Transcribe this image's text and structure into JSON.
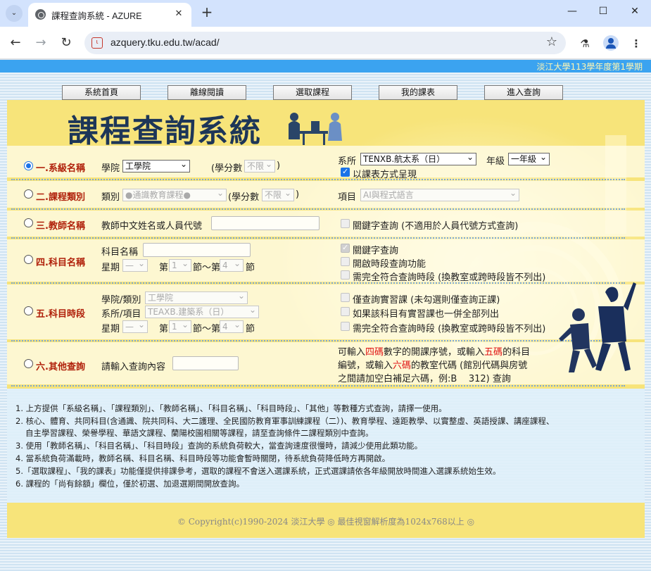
{
  "browser": {
    "tab_title": "課程查詢系統 - AZURE",
    "url": "azquery.tku.edu.tw/acad/"
  },
  "header": {
    "semester": "淡江大學113學年度第1學期"
  },
  "menu": [
    "系統首頁",
    "離線閱讀",
    "選取課程",
    "我的課表",
    "進入查詢"
  ],
  "main": {
    "title": "課程查詢系統",
    "rows": {
      "r1": {
        "label": "一.系級名稱",
        "college_label": "學院",
        "college_value": "工學院",
        "credits_open": "(學分數",
        "credits_value": "不限",
        "credits_close": ")",
        "dept_label": "系所",
        "dept_value": "TENXB.航太系（日）",
        "grade_label": "年級",
        "grade_value": "一年級",
        "timetable_label": "以課表方式呈現"
      },
      "r2": {
        "label": "二.課程類別",
        "type_label": "類別",
        "type_value": "●通識教育課程●",
        "credits_open": "(學分數",
        "credits_value": "不限",
        "credits_close": ")",
        "item_label": "項目",
        "item_value": "AI與程式語言"
      },
      "r3": {
        "label": "三.教師名稱",
        "teacher_label": "教師中文姓名或人員代號",
        "keyword_label": "關鍵字查詢 (不適用於人員代號方式查詢)"
      },
      "r4": {
        "label": "四.科目名稱",
        "subject_label": "科目名稱",
        "week_label": "星期",
        "week_value": "—",
        "period_prefix": "第",
        "period_from": "1",
        "period_mid": "節～第",
        "period_to": "4",
        "period_suffix": "節",
        "opt1": "關鍵字查詢",
        "opt2": "開啟時段查詢功能",
        "opt3": "需完全符合查詢時段 (換教室或跨時段皆不列出)"
      },
      "r5": {
        "label": "五.科目時段",
        "college_label": "學院/類別",
        "college_value": "工學院",
        "dept_label": "系所/項目",
        "dept_value": "TEAXB.建築系（日）",
        "week_label": "星期",
        "week_value": "—",
        "period_prefix": "第",
        "period_from": "1",
        "period_mid": "節～第",
        "period_to": "4",
        "period_suffix": "節",
        "opt1": "僅查詢實習課 (未勾選則僅查詢正課)",
        "opt2": "如果該科目有實習課也一併全部列出",
        "opt3": "需完全符合查詢時段 (換教室或跨時段皆不列出)"
      },
      "r6": {
        "label": "六.其他查詢",
        "input_label": "請輸入查詢內容",
        "help_1a": "可輸入",
        "help_1b": "四碼",
        "help_1c": "數字的開課序號，或輸入",
        "help_1d": "五碼",
        "help_1e": "的科目",
        "help_2a": "編號，或輸入",
        "help_2b": "六碼",
        "help_2c": "的教室代碼 (館別代碼與房號",
        "help_3": "之間請加空白補足六碼，例:B    312) 查詢"
      }
    }
  },
  "notes": [
    "1. 上方提供「系級名稱」、「課程類別」、「教師名稱」、「科目名稱」、「科目時段」、「其他」等數種方式查詢，請擇一使用。",
    "2. 核心、體育、共同科目(含通識、院共同科、大二護理、全民國防教育軍事訓練課程（二）)、教育學程、遠距教學、以實整虛、英語授課、講座課程、",
    "自主學習課程、榮譽學程、華語文課程、蘭陽校園相關等課程，請至查詢條件二課程類別中查詢。",
    "3. 使用「教師名稱」、「科目名稱」、「科目時段」查詢的系統負荷較大，當查詢速度很慢時，請減少使用此類功能。",
    "4. 當系統負荷滿載時，教師名稱、科目名稱、科目時段等功能會暫時關閉，待系統負荷降低時方再開啟。",
    "5.「選取課程」、「我的課表」功能僅提供排課參考，選取的課程不會送入選課系統，正式選課請依各年級開放時間進入選課系統始生效。",
    "6. 課程的「尚有餘額」欄位，僅於初選、加退選期間開放查詢。"
  ],
  "footer": "© Copyright(c)1990-2024 淡江大學 ◎ 最佳視窗解析度為1024x768以上 ◎"
}
